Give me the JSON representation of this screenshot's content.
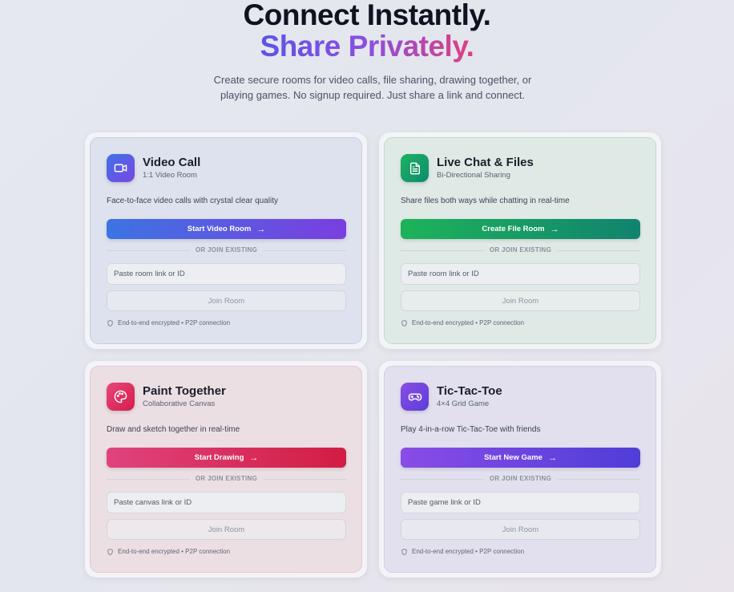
{
  "hero": {
    "title_line1": "Connect Instantly.",
    "title_line2": "Share Privately.",
    "subtitle": "Create secure rooms for video calls, file sharing, drawing together, or playing games. No signup required. Just share a link and connect."
  },
  "cards": [
    {
      "title": "Video Call",
      "subtitle": "1:1 Video Room",
      "icon": "video-camera-icon",
      "description": "Face-to-face video calls with crystal clear quality",
      "primary_label": "Start Video Room",
      "divider": "OR JOIN EXISTING",
      "input_placeholder": "Paste room link or ID",
      "join_label": "Join Room",
      "secure_note": "End-to-end encrypted • P2P connection",
      "accent": "#3c74e2"
    },
    {
      "title": "Live Chat & Files",
      "subtitle": "Bi-Directional Sharing",
      "icon": "file-document-icon",
      "description": "Share files both ways while chatting in real-time",
      "primary_label": "Create File Room",
      "divider": "OR JOIN EXISTING",
      "input_placeholder": "Paste room link or ID",
      "join_label": "Join Room",
      "secure_note": "End-to-end encrypted • P2P connection",
      "accent": "#1db35a"
    },
    {
      "title": "Paint Together",
      "subtitle": "Collaborative Canvas",
      "icon": "palette-icon",
      "description": "Draw and sketch together in real-time",
      "primary_label": "Start Drawing",
      "divider": "OR JOIN EXISTING",
      "input_placeholder": "Paste canvas link or ID",
      "join_label": "Join Room",
      "secure_note": "End-to-end encrypted • P2P connection",
      "accent": "#e0437e"
    },
    {
      "title": "Tic-Tac-Toe",
      "subtitle": "4×4 Grid Game",
      "icon": "gamepad-icon",
      "description": "Play 4-in-a-row Tic-Tac-Toe with friends",
      "primary_label": "Start New Game",
      "divider": "OR JOIN EXISTING",
      "input_placeholder": "Paste game link or ID",
      "join_label": "Join Room",
      "secure_note": "End-to-end encrypted • P2P connection",
      "accent": "#8a4ce6"
    }
  ]
}
